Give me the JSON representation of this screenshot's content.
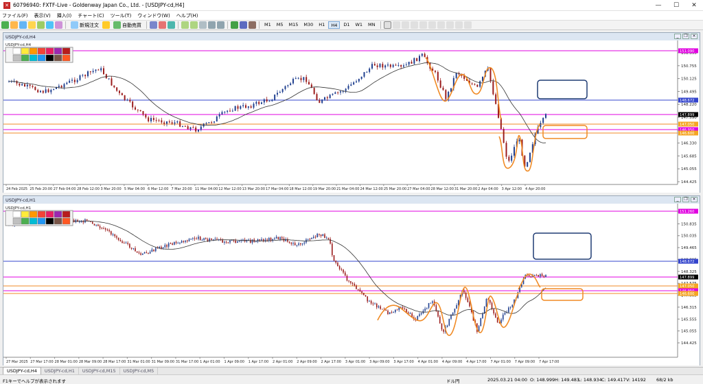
{
  "window_title": "60796940: FXTF-Live - Goldenway Japan Co., Ltd. - [USDJPY-cd,H4]",
  "menu": [
    "ファイル(F)",
    "表示(V)",
    "挿入(I)",
    "チャート(C)",
    "ツール(T)",
    "ウィンドウ(W)",
    "ヘルプ(H)"
  ],
  "toolbar": {
    "new_order": "新規注文",
    "auto_trading": "自動売買",
    "timeframes": [
      "M1",
      "M5",
      "M15",
      "M30",
      "H1",
      "H4",
      "D1",
      "W1",
      "MN"
    ],
    "active_timeframe": "H4"
  },
  "chart1": {
    "title": "USDJPY-cd,H4",
    "inner_title": "USDJPY-cd,H4",
    "price_labels": [
      "151.395",
      "150.755",
      "150.125",
      "149.495",
      "148.220",
      "147.590",
      "146.960",
      "146.330",
      "145.685",
      "145.055",
      "144.425"
    ],
    "hline_labels": {
      "magenta_top": "151.090",
      "blue": "148.672",
      "price": "147.899",
      "orange": "147.050",
      "magenta": "146.950",
      "orange2": "146.600"
    },
    "time_labels": [
      "24 Feb 2025",
      "25 Feb 20:00",
      "27 Feb 04:00",
      "28 Feb 12:00",
      "3 Mar 20:00",
      "5 Mar 04:00",
      "6 Mar 12:00",
      "7 Mar 20:00",
      "11 Mar 04:00",
      "12 Mar 12:00",
      "13 Mar 20:00",
      "17 Mar 04:00",
      "18 Mar 12:00",
      "19 Mar 20:00",
      "21 Mar 04:00",
      "24 Mar 12:00",
      "25 Mar 20:00",
      "27 Mar 04:00",
      "28 Mar 12:00",
      "31 Mar 20:00",
      "2 Apr 04:00",
      "3 Apr 12:00",
      "4 Apr 20:00"
    ]
  },
  "chart2": {
    "title": "USDJPY-cd,H1",
    "inner_title": "USDJPY-cd,H1",
    "price_labels": [
      "151.265",
      "150.835",
      "150.035",
      "149.465",
      "148.895",
      "148.325",
      "147.575",
      "147.005",
      "146.315",
      "145.555",
      "145.055",
      "144.425"
    ],
    "hline_labels": {
      "magenta_top": "151.260",
      "blue": "148.672",
      "price": "147.899",
      "orange": "147.050",
      "magenta": "146.950",
      "orange2": "146.600"
    },
    "time_labels": [
      "27 Mar 2025",
      "27 Mar 17:00",
      "28 Mar 01:00",
      "28 Mar 09:00",
      "28 Mar 17:00",
      "31 Mar 01:00",
      "31 Mar 09:00",
      "31 Mar 17:00",
      "1 Apr 01:00",
      "1 Apr 09:00",
      "1 Apr 17:00",
      "2 Apr 01:00",
      "2 Apr 09:00",
      "2 Apr 17:00",
      "3 Apr 01:00",
      "3 Apr 09:00",
      "3 Apr 17:00",
      "4 Apr 01:00",
      "4 Apr 09:00",
      "4 Apr 17:00",
      "7 Apr 01:00",
      "7 Apr 09:00",
      "7 Apr 17:00"
    ]
  },
  "tabs": [
    "USDJPY-cd,H4",
    "USDJPY-cd,H1",
    "USDJPY-cd,M15",
    "USDJPY-cd,M5"
  ],
  "active_tab": "USDJPY-cd,H4",
  "status": {
    "help": "F1キーでヘルプが表示されます",
    "profile": "ドル円",
    "time": "2025.03.21 04:00",
    "open": "O: 148.999",
    "high": "H: 149.483",
    "low": "L: 148.934",
    "close": "C: 149.417",
    "volume": "V: 14192",
    "traffic": "68/2 kb"
  },
  "colors": {
    "bull": "#1f3f8f",
    "bear": "#9b1c1c",
    "ma": "#333333",
    "magenta": "#e000e0",
    "blue": "#3344cc",
    "orange": "#f08a24",
    "zone_blue": "#1f3b73"
  }
}
